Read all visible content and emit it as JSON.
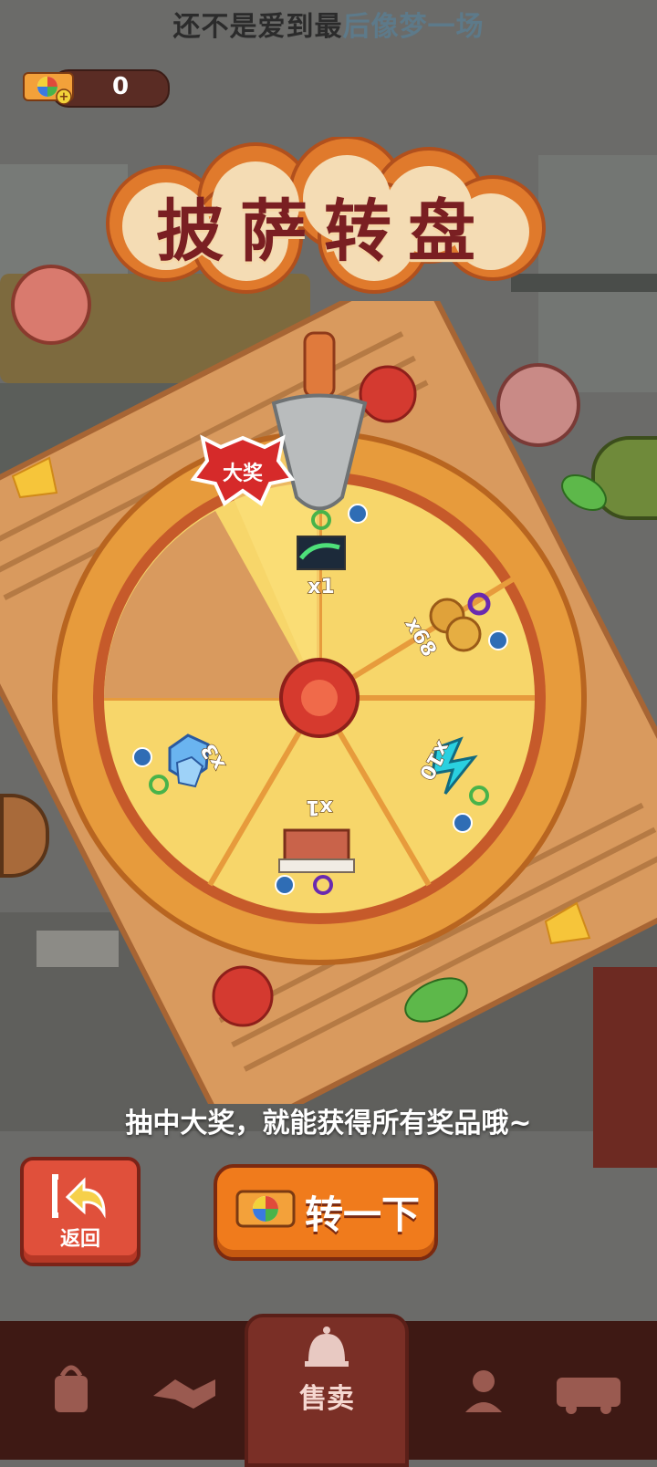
{
  "status_lyric": {
    "part1": "还不是爱到最",
    "part2": "后像梦一场"
  },
  "tickets": {
    "count": "0",
    "icon": "lottery-ticket-icon"
  },
  "title": "披萨转盘",
  "wheel": {
    "grand_prize_badge": "大奖",
    "prizes": [
      {
        "name": "aurora-photo",
        "label": "x1",
        "grand": true
      },
      {
        "name": "paw-cookies",
        "label": "x68"
      },
      {
        "name": "energy-bolt",
        "label": "x10"
      },
      {
        "name": "brick-block",
        "label": "x1"
      },
      {
        "name": "ice-crystal",
        "label": "x3"
      }
    ]
  },
  "tip": "抽中大奖，就能获得所有奖品哦~",
  "buttons": {
    "back_label": "返回",
    "spin_label": "转一下"
  },
  "nav": {
    "sell_label": "售卖",
    "icons": [
      "shop-bag-icon",
      "handshake-icon",
      "sell-bell-icon",
      "map-person-icon",
      "bus-icon"
    ]
  },
  "colors": {
    "accent_orange": "#f07b1c",
    "back_red": "#e0503b",
    "nav_bg": "#3e1914",
    "title_red": "#7a1f22"
  }
}
